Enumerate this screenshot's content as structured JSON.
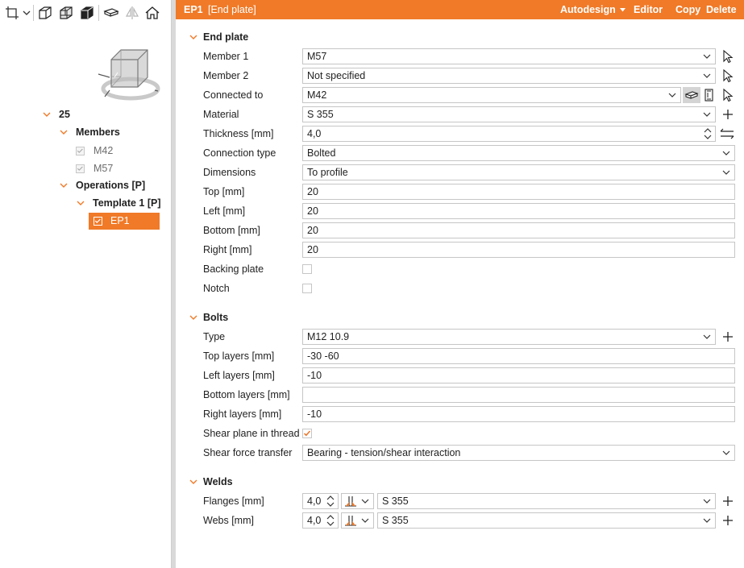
{
  "colors": {
    "accent": "#f07a28",
    "border": "#c6c6c6",
    "check": "#e8742a"
  },
  "toolbar": {
    "icons": [
      "crop-icon",
      "chevron-down-icon",
      "wireframe-cube-icon",
      "transparent-cube-icon",
      "solid-cube-icon",
      "section-box-icon",
      "mirror-icon",
      "home-icon"
    ]
  },
  "tree": {
    "root": "25",
    "members_label": "Members",
    "members": [
      "M42",
      "M57"
    ],
    "operations_label": "Operations [P]",
    "template_label": "Template 1 [P]",
    "selected_item": "EP1"
  },
  "header": {
    "id": "EP1",
    "name": "[End plate]",
    "actions": {
      "autodesign": "Autodesign",
      "editor": "Editor",
      "copy": "Copy",
      "delete": "Delete"
    }
  },
  "end_plate": {
    "title": "End plate",
    "member1": {
      "label": "Member 1",
      "value": "M57"
    },
    "member2": {
      "label": "Member 2",
      "value": "Not specified"
    },
    "connected_to": {
      "label": "Connected to",
      "value": "M42"
    },
    "material": {
      "label": "Material",
      "value": "S 355"
    },
    "thickness": {
      "label": "Thickness [mm]",
      "value": "4,0"
    },
    "connection_type": {
      "label": "Connection type",
      "value": "Bolted"
    },
    "dimensions": {
      "label": "Dimensions",
      "value": "To profile"
    },
    "top": {
      "label": "Top [mm]",
      "value": "20"
    },
    "left": {
      "label": "Left [mm]",
      "value": "20"
    },
    "bottom": {
      "label": "Bottom [mm]",
      "value": "20"
    },
    "right": {
      "label": "Right [mm]",
      "value": "20"
    },
    "backing_plate": {
      "label": "Backing plate",
      "checked": false
    },
    "notch": {
      "label": "Notch",
      "checked": false
    }
  },
  "bolts": {
    "title": "Bolts",
    "type": {
      "label": "Type",
      "value": "M12 10.9"
    },
    "top_layers": {
      "label": "Top layers [mm]",
      "value": "-30 -60"
    },
    "left_layers": {
      "label": "Left layers [mm]",
      "value": "-10"
    },
    "bottom_layers": {
      "label": "Bottom layers [mm]",
      "value": ""
    },
    "right_layers": {
      "label": "Right layers [mm]",
      "value": "-10"
    },
    "shear_plane": {
      "label": "Shear plane in thread",
      "checked": true
    },
    "shear_force": {
      "label": "Shear force transfer",
      "value": "Bearing - tension/shear interaction"
    }
  },
  "welds": {
    "title": "Welds",
    "flanges": {
      "label": "Flanges [mm]",
      "size": "4,0",
      "material": "S 355"
    },
    "webs": {
      "label": "Webs [mm]",
      "size": "4,0",
      "material": "S 355"
    }
  }
}
